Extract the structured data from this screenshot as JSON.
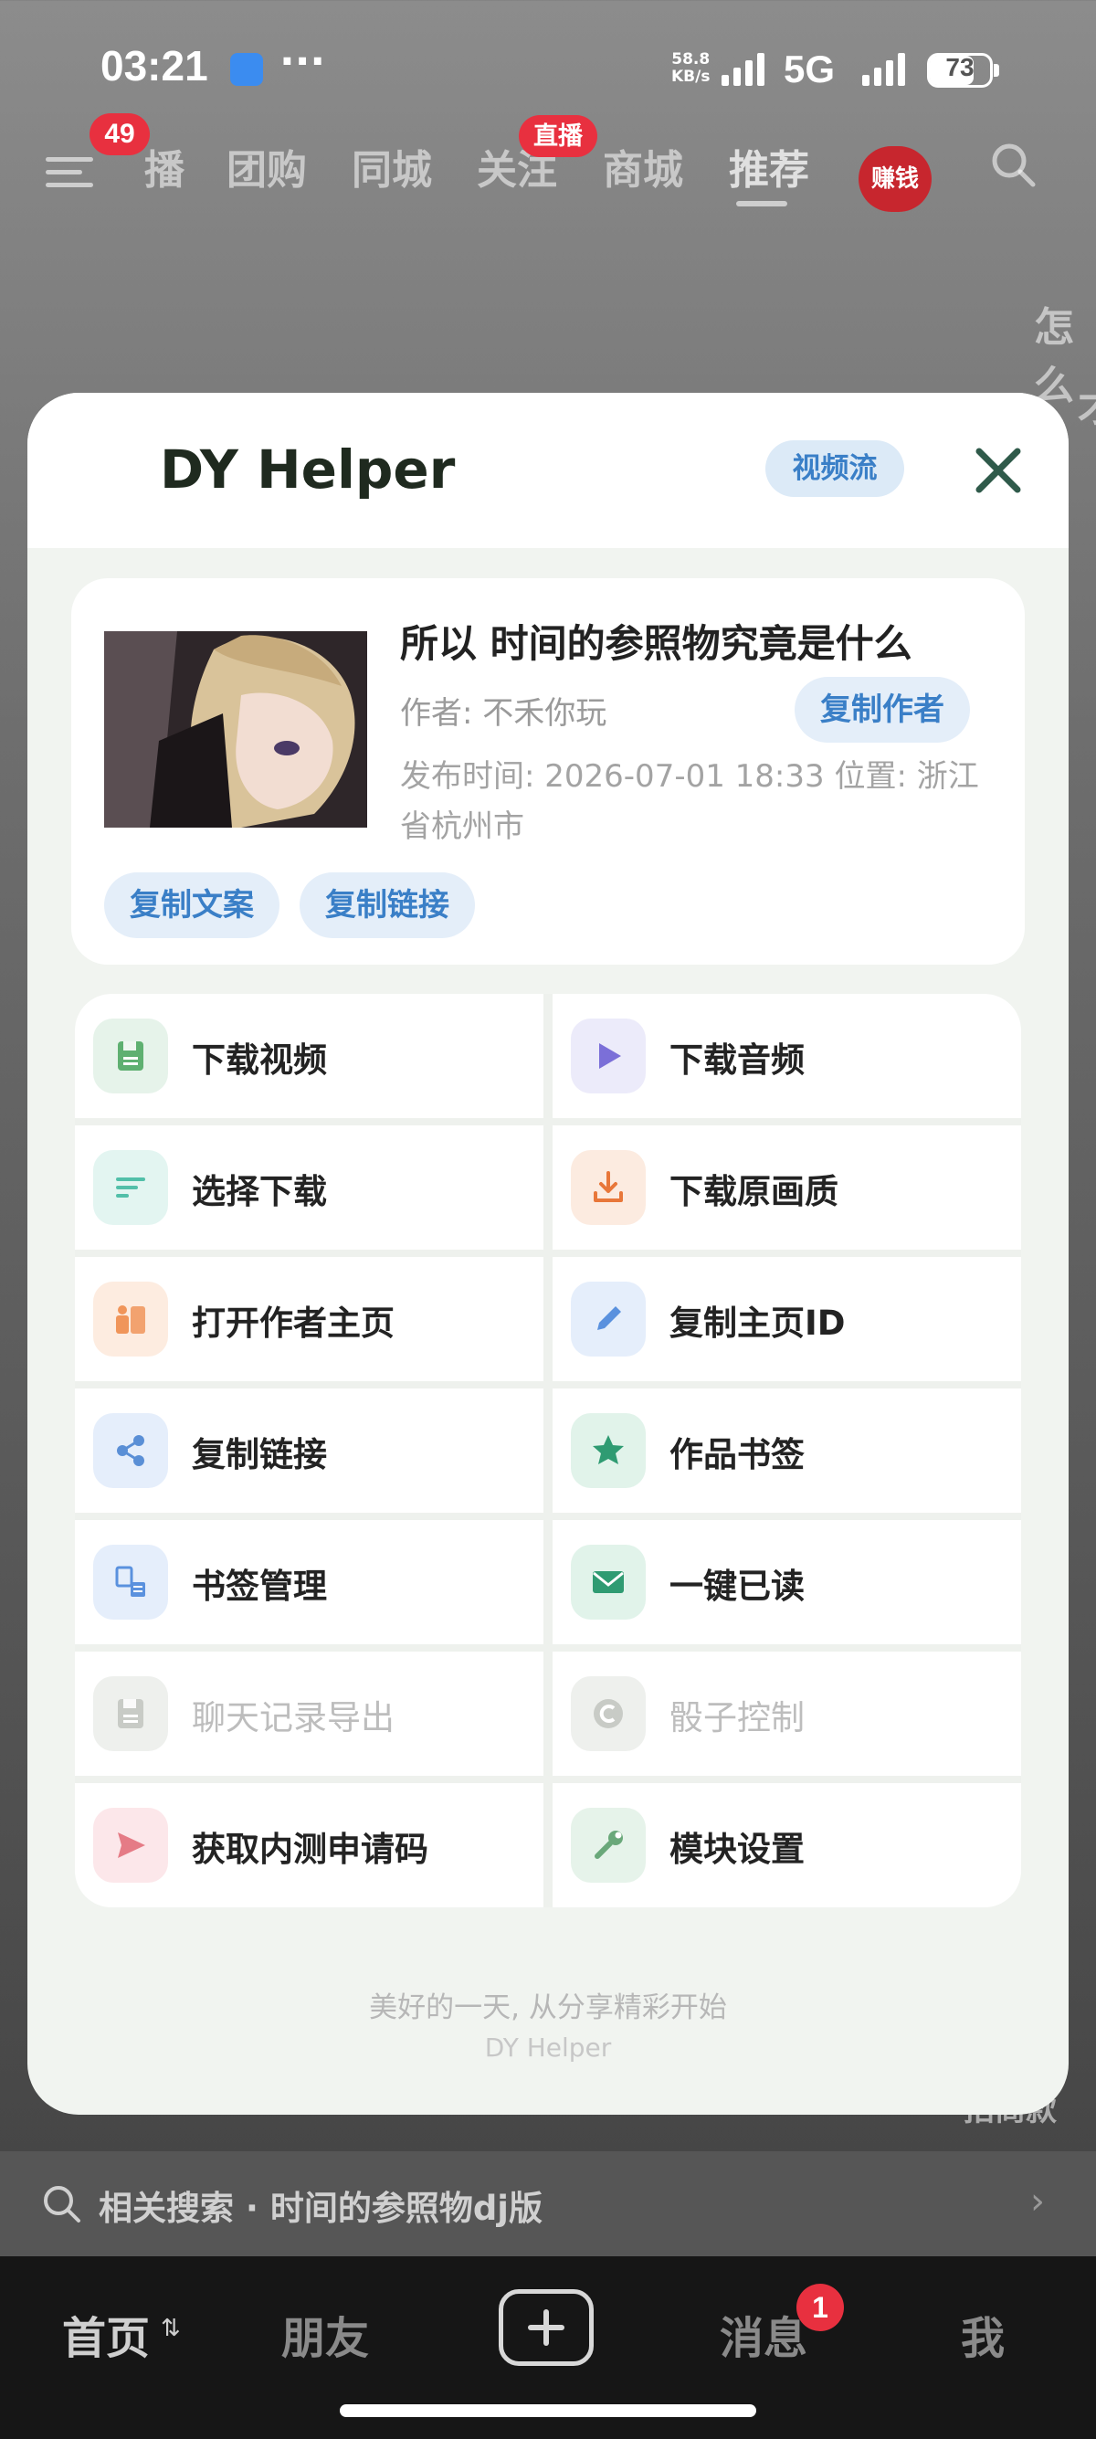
{
  "status_bar": {
    "time": "03:21",
    "more": "···",
    "speed_top": "58.8",
    "speed_unit": "KB/s",
    "network": "5G",
    "battery": "73"
  },
  "top_nav": {
    "menu_badge": "49",
    "tabs": [
      "播",
      "团购",
      "同城",
      "关注",
      "商城",
      "推荐"
    ],
    "live_badge": "直播",
    "earn_label": "赚钱",
    "side_text_1": "怎么",
    "side_text_2": "才"
  },
  "helper": {
    "title": "DY Helper",
    "mode_pill": "视频流",
    "video": {
      "title": "所以 时间的参照物究竟是什么",
      "author": "作者: 不禾你玩",
      "copy_author": "复制作者",
      "pub_info": "发布时间: 2026-07-01 18:33  位置: 浙江省杭州市",
      "copy_text": "复制文案",
      "copy_link": "复制链接"
    },
    "actions": [
      {
        "label": "下载视频",
        "icon": "save-icon",
        "color": "#5fb071",
        "bg": "#e6f3ea",
        "enabled": true
      },
      {
        "label": "下载音频",
        "icon": "play-icon",
        "color": "#7b6fd8",
        "bg": "#ecebfa",
        "enabled": true
      },
      {
        "label": "选择下载",
        "icon": "list-icon",
        "color": "#52bfa9",
        "bg": "#e3f5f1",
        "enabled": true
      },
      {
        "label": "下载原画质",
        "icon": "download-icon",
        "color": "#e8773a",
        "bg": "#fcebe0",
        "enabled": true
      },
      {
        "label": "打开作者主页",
        "icon": "people-icon",
        "color": "#f0955a",
        "bg": "#fdece0",
        "enabled": true
      },
      {
        "label": "复制主页ID",
        "icon": "pencil-icon",
        "color": "#5a91de",
        "bg": "#e5eefb",
        "enabled": true
      },
      {
        "label": "复制链接",
        "icon": "share-icon",
        "color": "#5a8fd6",
        "bg": "#e5eefb",
        "enabled": true
      },
      {
        "label": "作品书签",
        "icon": "star-icon",
        "color": "#2f9b72",
        "bg": "#e1f3ea",
        "enabled": true
      },
      {
        "label": "书签管理",
        "icon": "bookmark-manage-icon",
        "color": "#5a91de",
        "bg": "#e5eefb",
        "enabled": true
      },
      {
        "label": "一键已读",
        "icon": "mail-icon",
        "color": "#2f9b72",
        "bg": "#e1f3ea",
        "enabled": true
      },
      {
        "label": "聊天记录导出",
        "icon": "save-icon",
        "color": "#c8cbc6",
        "bg": "#eef0ed",
        "enabled": false
      },
      {
        "label": "骰子控制",
        "icon": "c-icon",
        "color": "#c8cbc6",
        "bg": "#eef0ed",
        "enabled": false
      },
      {
        "label": "获取内测申请码",
        "icon": "send-icon",
        "color": "#e57b86",
        "bg": "#fce7ea",
        "enabled": true
      },
      {
        "label": "模块设置",
        "icon": "wrench-icon",
        "color": "#6aa87a",
        "bg": "#e6f3ea",
        "enabled": true
      }
    ],
    "footer_slogan": "美好的一天, 从分享精彩开始",
    "footer_name": "DY Helper"
  },
  "related_search": {
    "text": "相关搜索 · 时间的参照物dj版"
  },
  "bottom_tabs": {
    "home": "首页",
    "friends": "朋友",
    "messages": "消息",
    "messages_badge": "1",
    "me": "我"
  },
  "behind_text": {
    "right_tag": "招商款"
  }
}
